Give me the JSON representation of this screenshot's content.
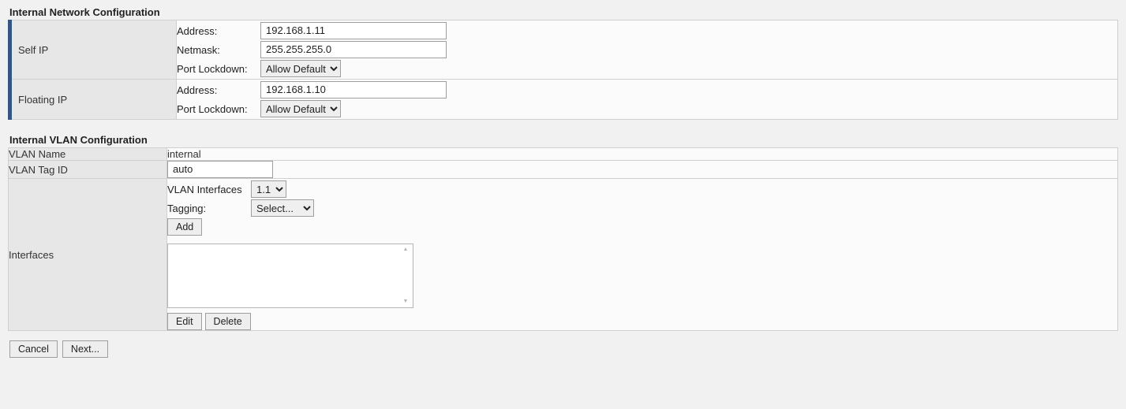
{
  "network": {
    "title": "Internal Network Configuration",
    "self_ip": {
      "label": "Self IP",
      "address_label": "Address:",
      "address_value": "192.168.1.11",
      "netmask_label": "Netmask:",
      "netmask_value": "255.255.255.0",
      "lockdown_label": "Port Lockdown:",
      "lockdown_value": "Allow Default"
    },
    "floating_ip": {
      "label": "Floating IP",
      "address_label": "Address:",
      "address_value": "192.168.1.10",
      "lockdown_label": "Port Lockdown:",
      "lockdown_value": "Allow Default"
    }
  },
  "vlan": {
    "title": "Internal VLAN Configuration",
    "name_label": "VLAN Name",
    "name_value": "internal",
    "tag_label": "VLAN Tag ID",
    "tag_value": "auto",
    "interfaces_label": "Interfaces",
    "iface_select_label": "VLAN Interfaces",
    "iface_select_value": "1.1",
    "tagging_label": "Tagging:",
    "tagging_value": "Select...",
    "add_label": "Add",
    "edit_label": "Edit",
    "delete_label": "Delete"
  },
  "footer": {
    "cancel_label": "Cancel",
    "next_label": "Next..."
  }
}
